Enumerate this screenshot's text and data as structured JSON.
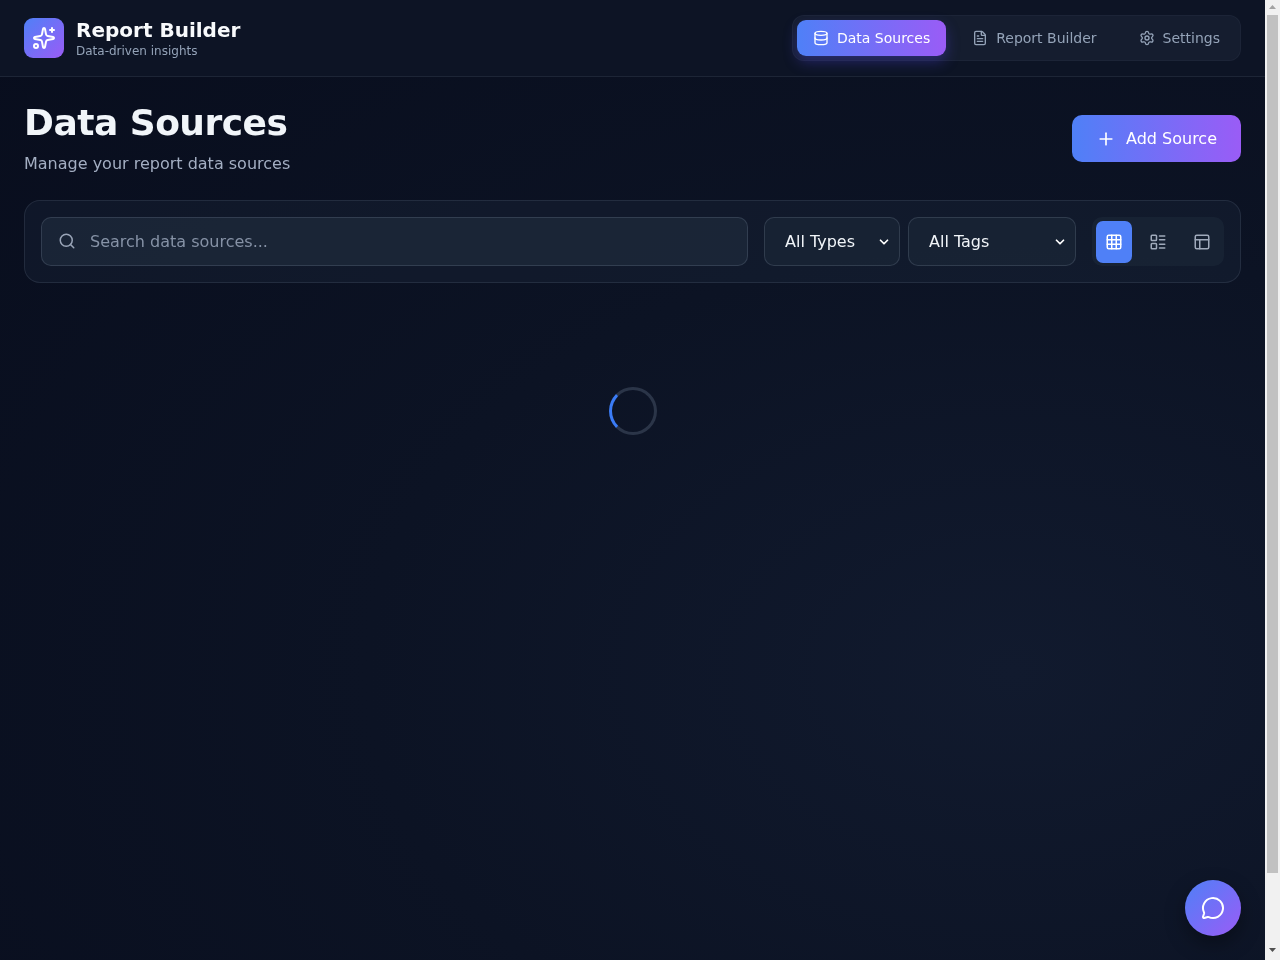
{
  "app": {
    "title": "Report Builder",
    "subtitle": "Data-driven insights"
  },
  "nav_tabs": [
    {
      "kind": "database",
      "label": "Data Sources",
      "selected": true
    },
    {
      "kind": "document",
      "label": "Report Builder",
      "selected": false
    },
    {
      "kind": "settings",
      "label": "Settings",
      "selected": false
    }
  ],
  "page": {
    "title": "Data Sources",
    "subtitle": "Manage your report data sources",
    "add_button": "Add Source"
  },
  "filters": {
    "search": {
      "placeholder": "Search data sources..."
    },
    "type_select": {
      "value": "All Types"
    },
    "tag_select": {
      "value": "All Tags"
    },
    "view_modes": [
      {
        "kind": "grid",
        "selected": true
      },
      {
        "kind": "list",
        "selected": false
      },
      {
        "kind": "panels",
        "selected": false
      }
    ]
  },
  "loading": true
}
